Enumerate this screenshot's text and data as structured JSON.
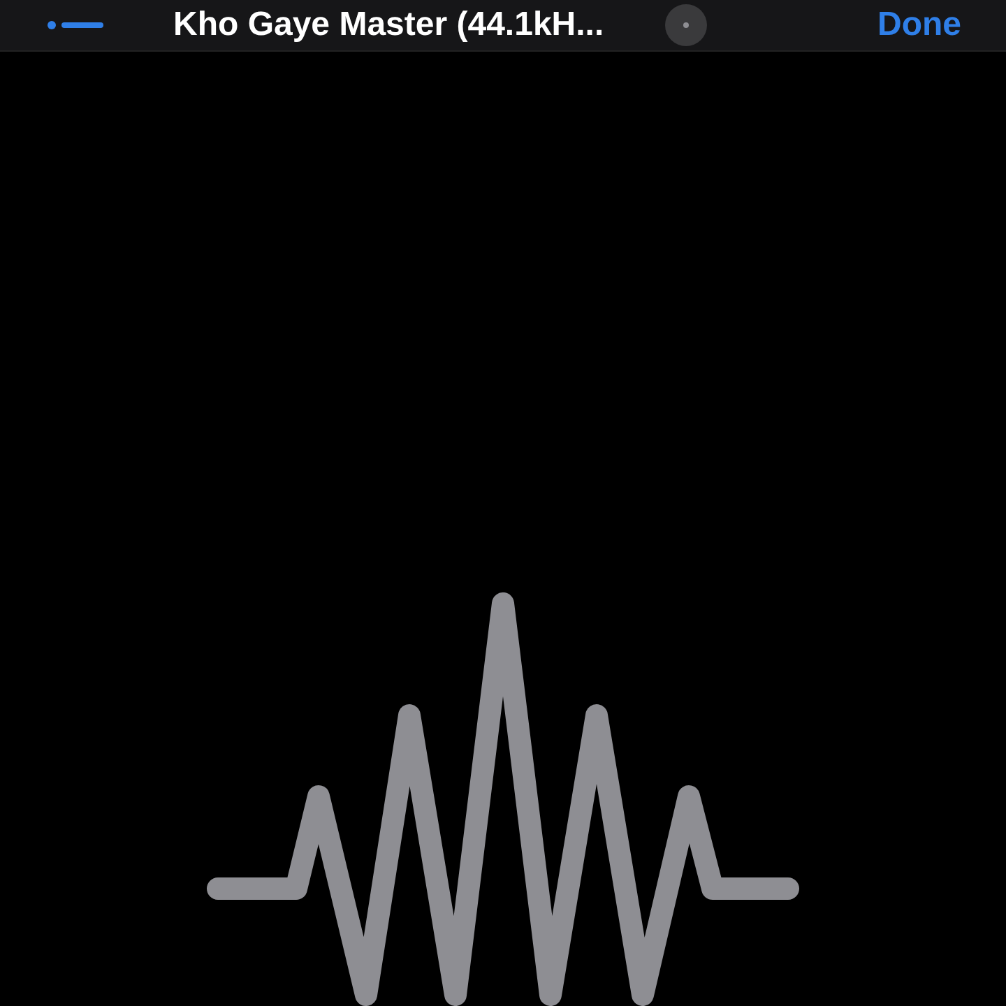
{
  "nav_bar": {
    "title": "Kho Gaye Master (44.1kH...",
    "done": "Done"
  }
}
